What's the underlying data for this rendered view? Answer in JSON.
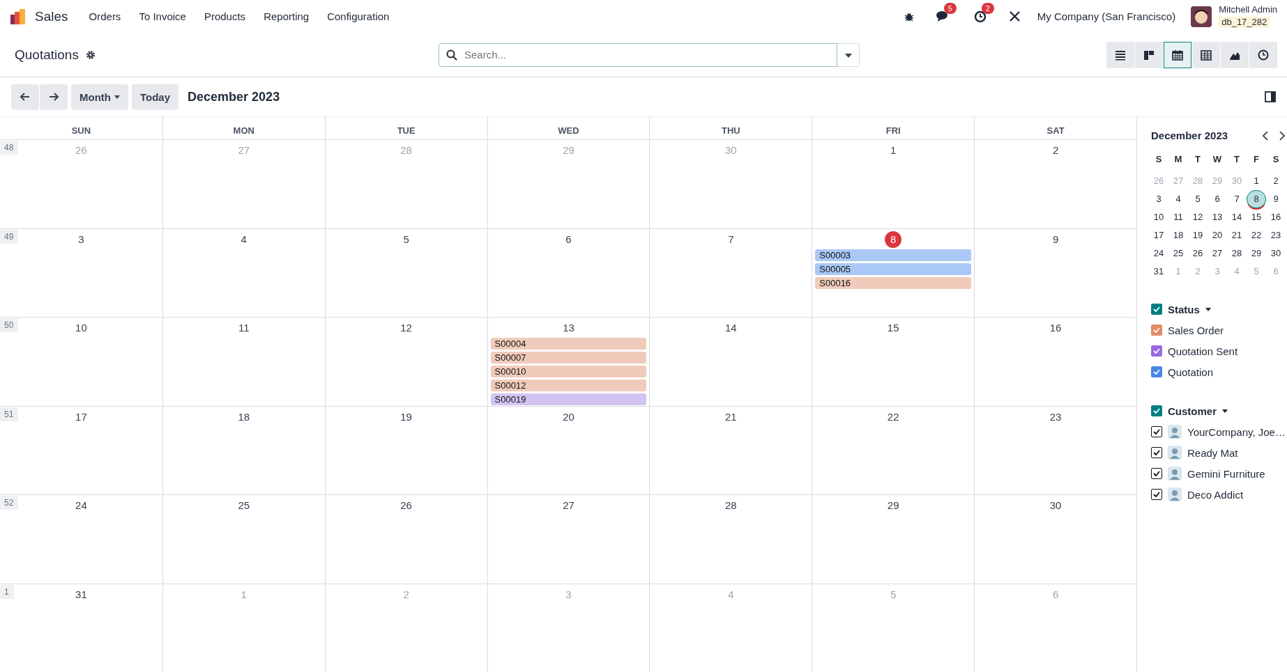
{
  "navbar": {
    "app_name": "Sales",
    "menu": [
      "Orders",
      "To Invoice",
      "Products",
      "Reporting",
      "Configuration"
    ],
    "messages_badge": "5",
    "activities_badge": "2",
    "company": "My Company (San Francisco)",
    "user_name": "Mitchell Admin",
    "database": "db_17_282"
  },
  "control_panel": {
    "title": "Quotations",
    "search": {
      "placeholder": "Search..."
    },
    "views": [
      {
        "kind": "list",
        "selected": false
      },
      {
        "kind": "kanban",
        "selected": false
      },
      {
        "kind": "calendar",
        "selected": true
      },
      {
        "kind": "pivot",
        "selected": false
      },
      {
        "kind": "graph",
        "selected": false
      },
      {
        "kind": "activity",
        "selected": false
      }
    ]
  },
  "calendar_toolbar": {
    "scale": "Month",
    "today_button": "Today",
    "period": "December 2023"
  },
  "calendar": {
    "weekdays": [
      "SUN",
      "MON",
      "TUE",
      "WED",
      "THU",
      "FRI",
      "SAT"
    ],
    "weeks": [
      {
        "number": "48",
        "days": [
          {
            "day": "26",
            "in_month": false,
            "today": false
          },
          {
            "day": "27",
            "in_month": false,
            "today": false
          },
          {
            "day": "28",
            "in_month": false,
            "today": false
          },
          {
            "day": "29",
            "in_month": false,
            "today": false
          },
          {
            "day": "30",
            "in_month": false,
            "today": false
          },
          {
            "day": "1",
            "in_month": true,
            "today": false
          },
          {
            "day": "2",
            "in_month": true,
            "today": false
          }
        ]
      },
      {
        "number": "49",
        "days": [
          {
            "day": "3",
            "in_month": true,
            "today": false
          },
          {
            "day": "4",
            "in_month": true,
            "today": false
          },
          {
            "day": "5",
            "in_month": true,
            "today": false
          },
          {
            "day": "6",
            "in_month": true,
            "today": false
          },
          {
            "day": "7",
            "in_month": true,
            "today": false
          },
          {
            "day": "8",
            "in_month": true,
            "today": true,
            "events": [
              {
                "label": "S00003",
                "color": "#a9c8f5"
              },
              {
                "label": "S00005",
                "color": "#a9c8f5"
              },
              {
                "label": "S00016",
                "color": "#f0cbbb"
              }
            ]
          },
          {
            "day": "9",
            "in_month": true,
            "today": false
          }
        ]
      },
      {
        "number": "50",
        "days": [
          {
            "day": "10",
            "in_month": true,
            "today": false
          },
          {
            "day": "11",
            "in_month": true,
            "today": false
          },
          {
            "day": "12",
            "in_month": true,
            "today": false
          },
          {
            "day": "13",
            "in_month": true,
            "today": false,
            "events": [
              {
                "label": "S00004",
                "color": "#f0cbbb"
              },
              {
                "label": "S00007",
                "color": "#f0cbbb"
              },
              {
                "label": "S00010",
                "color": "#f0cbbb"
              },
              {
                "label": "S00012",
                "color": "#f0cbbb"
              },
              {
                "label": "S00019",
                "color": "#d3c4f2"
              }
            ]
          },
          {
            "day": "14",
            "in_month": true,
            "today": false
          },
          {
            "day": "15",
            "in_month": true,
            "today": false
          },
          {
            "day": "16",
            "in_month": true,
            "today": false
          }
        ]
      },
      {
        "number": "51",
        "days": [
          {
            "day": "17",
            "in_month": true,
            "today": false
          },
          {
            "day": "18",
            "in_month": true,
            "today": false
          },
          {
            "day": "19",
            "in_month": true,
            "today": false
          },
          {
            "day": "20",
            "in_month": true,
            "today": false
          },
          {
            "day": "21",
            "in_month": true,
            "today": false
          },
          {
            "day": "22",
            "in_month": true,
            "today": false
          },
          {
            "day": "23",
            "in_month": true,
            "today": false
          }
        ]
      },
      {
        "number": "52",
        "days": [
          {
            "day": "24",
            "in_month": true,
            "today": false
          },
          {
            "day": "25",
            "in_month": true,
            "today": false
          },
          {
            "day": "26",
            "in_month": true,
            "today": false
          },
          {
            "day": "27",
            "in_month": true,
            "today": false
          },
          {
            "day": "28",
            "in_month": true,
            "today": false
          },
          {
            "day": "29",
            "in_month": true,
            "today": false
          },
          {
            "day": "30",
            "in_month": true,
            "today": false
          }
        ]
      },
      {
        "number": "1",
        "days": [
          {
            "day": "31",
            "in_month": true,
            "today": false
          },
          {
            "day": "1",
            "in_month": false,
            "today": false
          },
          {
            "day": "2",
            "in_month": false,
            "today": false
          },
          {
            "day": "3",
            "in_month": false,
            "today": false
          },
          {
            "day": "4",
            "in_month": false,
            "today": false
          },
          {
            "day": "5",
            "in_month": false,
            "today": false
          },
          {
            "day": "6",
            "in_month": false,
            "today": false
          }
        ]
      }
    ]
  },
  "sidebar": {
    "mini_calendar": {
      "title": "December 2023",
      "weekdays": [
        "S",
        "M",
        "T",
        "W",
        "T",
        "F",
        "S"
      ],
      "weeks": [
        [
          {
            "day": "26",
            "in_month": false,
            "selected": false,
            "today": false
          },
          {
            "day": "27",
            "in_month": false,
            "selected": false,
            "today": false
          },
          {
            "day": "28",
            "in_month": false,
            "selected": false,
            "today": false
          },
          {
            "day": "29",
            "in_month": false,
            "selected": false,
            "today": false
          },
          {
            "day": "30",
            "in_month": false,
            "selected": false,
            "today": false
          },
          {
            "day": "1",
            "in_month": true,
            "selected": false,
            "today": false
          },
          {
            "day": "2",
            "in_month": true,
            "selected": false,
            "today": false
          }
        ],
        [
          {
            "day": "3",
            "in_month": true,
            "selected": false,
            "today": false
          },
          {
            "day": "4",
            "in_month": true,
            "selected": false,
            "today": false
          },
          {
            "day": "5",
            "in_month": true,
            "selected": false,
            "today": false
          },
          {
            "day": "6",
            "in_month": true,
            "selected": false,
            "today": false
          },
          {
            "day": "7",
            "in_month": true,
            "selected": false,
            "today": false
          },
          {
            "day": "8",
            "in_month": true,
            "selected": true,
            "today": true
          },
          {
            "day": "9",
            "in_month": true,
            "selected": false,
            "today": false
          }
        ],
        [
          {
            "day": "10",
            "in_month": true,
            "selected": false,
            "today": false
          },
          {
            "day": "11",
            "in_month": true,
            "selected": false,
            "today": false
          },
          {
            "day": "12",
            "in_month": true,
            "selected": false,
            "today": false
          },
          {
            "day": "13",
            "in_month": true,
            "selected": false,
            "today": false
          },
          {
            "day": "14",
            "in_month": true,
            "selected": false,
            "today": false
          },
          {
            "day": "15",
            "in_month": true,
            "selected": false,
            "today": false
          },
          {
            "day": "16",
            "in_month": true,
            "selected": false,
            "today": false
          }
        ],
        [
          {
            "day": "17",
            "in_month": true,
            "selected": false,
            "today": false
          },
          {
            "day": "18",
            "in_month": true,
            "selected": false,
            "today": false
          },
          {
            "day": "19",
            "in_month": true,
            "selected": false,
            "today": false
          },
          {
            "day": "20",
            "in_month": true,
            "selected": false,
            "today": false
          },
          {
            "day": "21",
            "in_month": true,
            "selected": false,
            "today": false
          },
          {
            "day": "22",
            "in_month": true,
            "selected": false,
            "today": false
          },
          {
            "day": "23",
            "in_month": true,
            "selected": false,
            "today": false
          }
        ],
        [
          {
            "day": "24",
            "in_month": true,
            "selected": false,
            "today": false
          },
          {
            "day": "25",
            "in_month": true,
            "selected": false,
            "today": false
          },
          {
            "day": "26",
            "in_month": true,
            "selected": false,
            "today": false
          },
          {
            "day": "27",
            "in_month": true,
            "selected": false,
            "today": false
          },
          {
            "day": "28",
            "in_month": true,
            "selected": false,
            "today": false
          },
          {
            "day": "29",
            "in_month": true,
            "selected": false,
            "today": false
          },
          {
            "day": "30",
            "in_month": true,
            "selected": false,
            "today": false
          }
        ],
        [
          {
            "day": "31",
            "in_month": true,
            "selected": false,
            "today": false
          },
          {
            "day": "1",
            "in_month": false,
            "selected": false,
            "today": false
          },
          {
            "day": "2",
            "in_month": false,
            "selected": false,
            "today": false
          },
          {
            "day": "3",
            "in_month": false,
            "selected": false,
            "today": false
          },
          {
            "day": "4",
            "in_month": false,
            "selected": false,
            "today": false
          },
          {
            "day": "5",
            "in_month": false,
            "selected": false,
            "today": false
          },
          {
            "day": "6",
            "in_month": false,
            "selected": false,
            "today": false
          }
        ]
      ]
    },
    "filters": [
      {
        "title": "Status",
        "checked": true,
        "items": [
          {
            "label": "Sales Order",
            "checked": true,
            "color": "#e38d64"
          },
          {
            "label": "Quotation Sent",
            "checked": true,
            "color": "#9a6ae0"
          },
          {
            "label": "Quotation",
            "checked": true,
            "color": "#4a86e8"
          }
        ]
      },
      {
        "title": "Customer",
        "checked": true,
        "items": [
          {
            "label": "YourCompany, Joe…",
            "checked": true
          },
          {
            "label": "Ready Mat",
            "checked": true
          },
          {
            "label": "Gemini Furniture",
            "checked": true
          },
          {
            "label": "Deco Addict",
            "checked": true
          }
        ]
      }
    ]
  }
}
